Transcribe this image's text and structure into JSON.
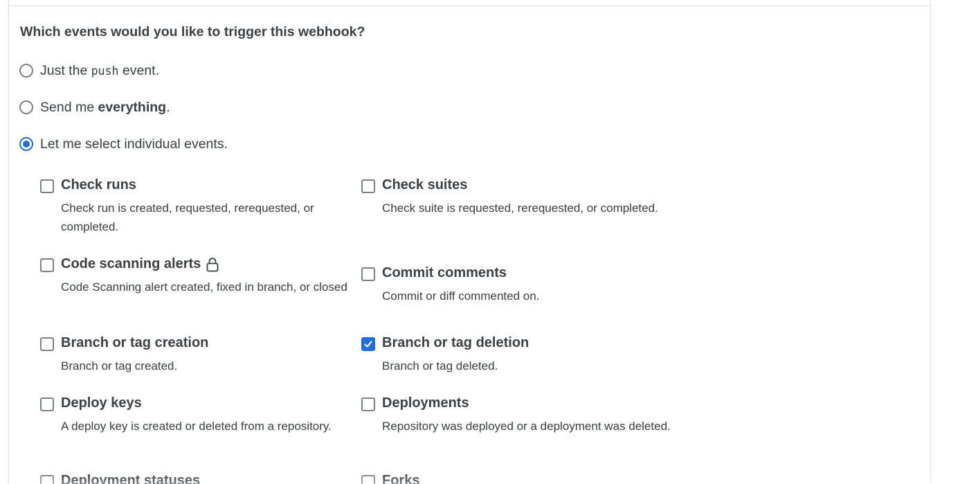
{
  "section": {
    "heading": "Which events would you like to trigger this webhook?"
  },
  "trigger_options": [
    {
      "before": "Just the ",
      "code": "push",
      "strong": "",
      "after": " event.",
      "selected": false
    },
    {
      "before": "Send me ",
      "code": "",
      "strong": "everything",
      "after": ".",
      "selected": false
    },
    {
      "before": "Let me select individual events.",
      "code": "",
      "strong": "",
      "after": "",
      "selected": true
    }
  ],
  "events": [
    {
      "title": "Check runs",
      "desc": "Check run is created, requested, rerequested, or completed.",
      "checked": false,
      "locked": false
    },
    {
      "title": "Check suites",
      "desc": "Check suite is requested, rerequested, or completed.",
      "checked": false,
      "locked": false
    },
    {
      "title": "Code scanning alerts",
      "desc": "Code Scanning alert created, fixed in branch, or closed",
      "checked": false,
      "locked": true,
      "icon": "lock-icon"
    },
    {
      "title": "Commit comments",
      "desc": "Commit or diff commented on.",
      "checked": false,
      "locked": false
    },
    {
      "title": "Branch or tag creation",
      "desc": "Branch or tag created.",
      "checked": false,
      "locked": false
    },
    {
      "title": "Branch or tag deletion",
      "desc": "Branch or tag deleted.",
      "checked": true,
      "locked": false
    },
    {
      "title": "Deploy keys",
      "desc": "A deploy key is created or deleted from a repository.",
      "checked": false,
      "locked": false
    },
    {
      "title": "Deployments",
      "desc": "Repository was deployed or a deployment was deleted.",
      "checked": false,
      "locked": false
    },
    {
      "title": "Deployment statuses",
      "desc": "",
      "checked": false,
      "locked": false
    },
    {
      "title": "Forks",
      "desc": "",
      "checked": false,
      "locked": false
    }
  ],
  "colors": {
    "accent": "#1f6fe0",
    "text": "#3b4045",
    "border": "#d8dee4"
  }
}
